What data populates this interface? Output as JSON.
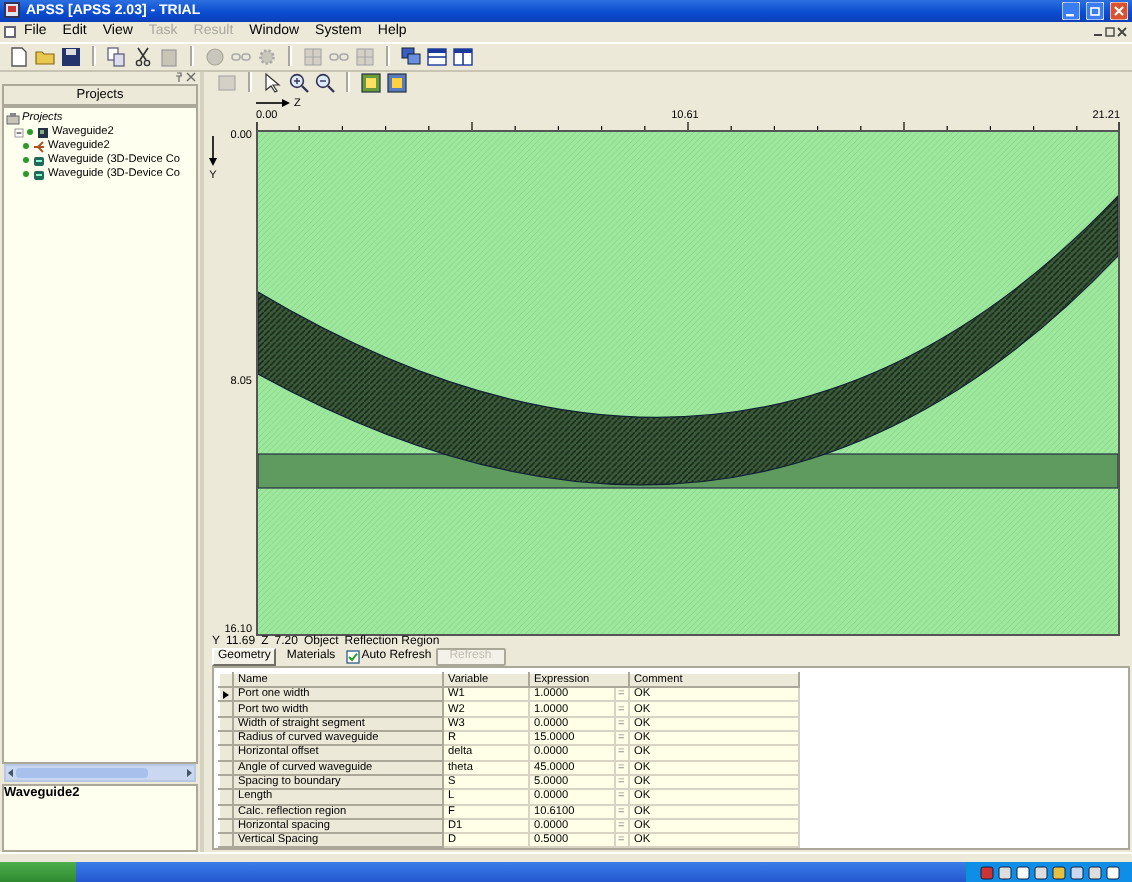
{
  "window": {
    "title": "APSS [APSS 2.03] - TRIAL"
  },
  "menu": [
    {
      "label": "File",
      "disabled": false
    },
    {
      "label": "Edit",
      "disabled": false
    },
    {
      "label": "View",
      "disabled": false
    },
    {
      "label": "Task",
      "disabled": true
    },
    {
      "label": "Result",
      "disabled": true
    },
    {
      "label": "Window",
      "disabled": false
    },
    {
      "label": "System",
      "disabled": false
    },
    {
      "label": "Help",
      "disabled": false
    }
  ],
  "projects_panel": {
    "title": "Projects",
    "tree": [
      {
        "label": "Projects",
        "kind": "root",
        "children": [
          {
            "label": "Waveguide2",
            "kind": "project",
            "expanded": true,
            "children": [
              {
                "label": "Waveguide2",
                "kind": "layout"
              },
              {
                "label": "Waveguide (3D-Device Co",
                "kind": "device"
              },
              {
                "label": "Waveguide (3D-Device Co",
                "kind": "device"
              }
            ]
          }
        ]
      }
    ],
    "selected_name": "Waveguide2"
  },
  "canvas": {
    "z_axis_label": "Z",
    "y_axis_label": "Y",
    "z_ticks": [
      "0.00",
      "10.61",
      "21.21"
    ],
    "y_ticks": [
      "0.00",
      "8.05",
      "16.10"
    ]
  },
  "status": [
    {
      "label": "Y",
      "value": "11.69"
    },
    {
      "label": "Z",
      "value": "7.20"
    },
    {
      "label": "Object",
      "value": "Reflection Region"
    }
  ],
  "tabs": [
    {
      "label": "Geometry",
      "selected": true
    },
    {
      "label": "Materials",
      "selected": false
    }
  ],
  "auto_refresh": {
    "label": "Auto Refresh",
    "checked": true
  },
  "refresh_button": {
    "label": "Refresh",
    "disabled": true
  },
  "table": {
    "columns": [
      "Name",
      "Variable",
      "Expression",
      "Comment"
    ],
    "rows": [
      {
        "name": "Port one width",
        "variable": "W1",
        "expression": "1.0000",
        "relation": "=",
        "comment": "OK",
        "selected": true
      },
      {
        "name": "Port two width",
        "variable": "W2",
        "expression": "1.0000",
        "relation": "=",
        "comment": "OK",
        "selected": false
      },
      {
        "name": "Width of straight segment",
        "variable": "W3",
        "expression": "0.0000",
        "relation": "=",
        "comment": "OK",
        "selected": false
      },
      {
        "name": "Radius of curved waveguide",
        "variable": "R",
        "expression": "15.0000",
        "relation": "=",
        "comment": "OK",
        "selected": false
      },
      {
        "name": "Horizontal offset",
        "variable": "delta",
        "expression": "0.0000",
        "relation": "=",
        "comment": "OK",
        "selected": false
      },
      {
        "name": "Angle of curved waveguide",
        "variable": "theta",
        "expression": "45.0000",
        "relation": "=",
        "comment": "OK",
        "selected": false
      },
      {
        "name": "Spacing to boundary",
        "variable": "S",
        "expression": "5.0000",
        "relation": "=",
        "comment": "OK",
        "selected": false
      },
      {
        "name": "Length",
        "variable": "L",
        "expression": "0.0000",
        "relation": "=",
        "comment": "OK",
        "selected": false
      },
      {
        "name": "Calc. reflection region",
        "variable": "F",
        "expression": "10.6100",
        "relation": "=",
        "comment": "OK",
        "selected": false
      },
      {
        "name": "Horizontal spacing",
        "variable": "D1",
        "expression": "0.0000",
        "relation": "=",
        "comment": "OK",
        "selected": false
      },
      {
        "name": "Vertical Spacing",
        "variable": "D",
        "expression": "0.5000",
        "relation": "=",
        "comment": "OK",
        "selected": false
      }
    ]
  }
}
